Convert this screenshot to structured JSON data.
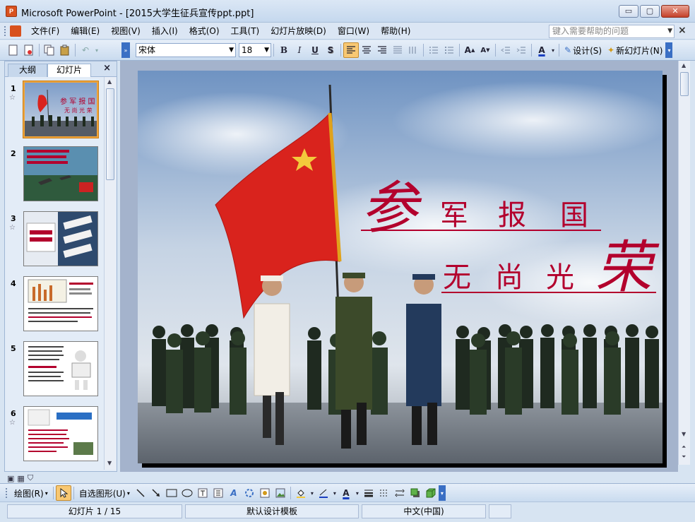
{
  "window": {
    "app_icon": "powerpoint-icon",
    "title": "Microsoft PowerPoint - [2015大学生征兵宣传ppt.ppt]",
    "buttons": {
      "minimize": "▭",
      "restore": "▢",
      "close": "✕"
    }
  },
  "menu": {
    "items": [
      "文件(F)",
      "编辑(E)",
      "视图(V)",
      "插入(I)",
      "格式(O)",
      "工具(T)",
      "幻灯片放映(D)",
      "窗口(W)",
      "帮助(H)"
    ],
    "help_placeholder": "键入需要帮助的问题"
  },
  "toolbar": {
    "font": "宋体",
    "font_size": "18",
    "bold": "B",
    "italic": "I",
    "underline": "U",
    "shadow": "S",
    "design_label": "设计(S)",
    "new_slide_label": "新幻灯片(N)"
  },
  "pane": {
    "tab_outline": "大纲",
    "tab_slides": "幻灯片",
    "close": "×",
    "thumbnails": [
      {
        "num": "1",
        "star": true
      },
      {
        "num": "2",
        "star": false
      },
      {
        "num": "3",
        "star": true
      },
      {
        "num": "4",
        "star": false
      },
      {
        "num": "5",
        "star": false
      },
      {
        "num": "6",
        "star": true
      }
    ]
  },
  "slide": {
    "line1_big": "参",
    "line1_rest": [
      "军",
      "报",
      "国"
    ],
    "line2_rest": [
      "无",
      "尚",
      "光"
    ],
    "line2_big": "荣",
    "colors": {
      "text": "#b3002d",
      "sky_top": "#6f93c2",
      "flag": "#d9231d"
    }
  },
  "drawbar": {
    "draw_label": "绘图(R)",
    "autoshapes_label": "自选图形(U)"
  },
  "status": {
    "slide_info": "幻灯片 1 / 15",
    "template": "默认设计模板",
    "language": "中文(中国)"
  }
}
